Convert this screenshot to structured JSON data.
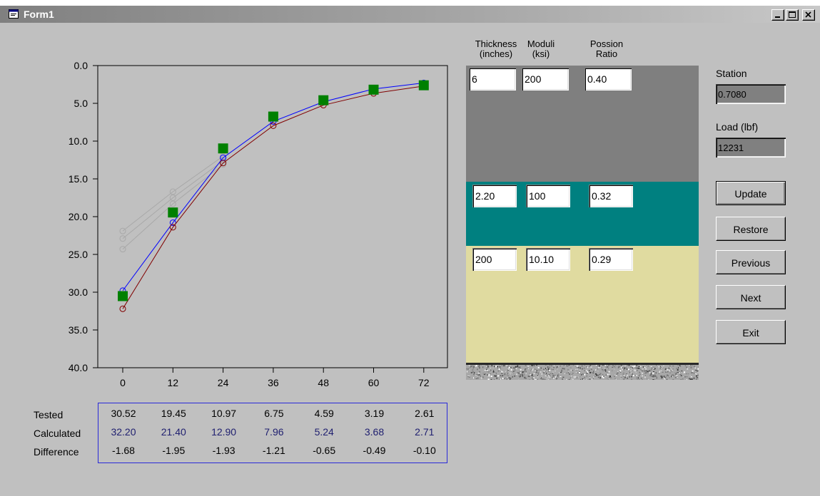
{
  "window": {
    "title": "Form1",
    "controls": {
      "minimize": "minimize",
      "maximize": "maximize",
      "close": "close"
    }
  },
  "chart_data": {
    "type": "line",
    "title": "",
    "xlabel": "",
    "ylabel": "",
    "x": [
      0,
      12,
      24,
      36,
      48,
      60,
      72
    ],
    "x_tick_labels": [
      "0",
      "12",
      "24",
      "36",
      "48",
      "60",
      "72"
    ],
    "ylim": [
      0,
      40
    ],
    "y_inverted": true,
    "y_ticks": [
      0,
      5,
      10,
      15,
      20,
      25,
      30,
      35,
      40
    ],
    "y_tick_labels": [
      "0.0",
      "5.0",
      "10.0",
      "15.0",
      "20.0",
      "25.0",
      "30.0",
      "35.0",
      "40.0"
    ],
    "grid": false,
    "series": [
      {
        "role": "tested",
        "marker": "square",
        "color": "#008000",
        "values": [
          30.52,
          19.45,
          10.97,
          6.75,
          4.59,
          3.19,
          2.61
        ]
      },
      {
        "role": "calculated",
        "marker": "circle",
        "color": "#800000",
        "values": [
          32.2,
          21.4,
          12.9,
          7.96,
          5.24,
          3.68,
          2.71
        ]
      },
      {
        "role": "previous-fit",
        "marker": "circle",
        "color": "#0000ff",
        "values": [
          29.8,
          20.8,
          12.2,
          7.4,
          4.8,
          3.1,
          2.3
        ]
      },
      {
        "role": "earlier-fit",
        "marker": "circle",
        "color": "#a8a8a8",
        "values": [
          21.9,
          16.7,
          12.0
        ]
      },
      {
        "role": "earlier-fit",
        "marker": "circle",
        "color": "#a8a8a8",
        "values": [
          22.9,
          17.5,
          12.6
        ]
      },
      {
        "role": "earlier-fit",
        "marker": "circle",
        "color": "#a8a8a8",
        "values": [
          24.3,
          18.3,
          13.1
        ]
      }
    ]
  },
  "table": {
    "row_labels": [
      "Tested",
      "Calculated",
      "Difference"
    ],
    "tested": [
      "30.52",
      "19.45",
      "10.97",
      "6.75",
      "4.59",
      "3.19",
      "2.61"
    ],
    "calculated": [
      "32.20",
      "21.40",
      "12.90",
      "7.96",
      "5.24",
      "3.68",
      "2.71"
    ],
    "difference": [
      "-1.68",
      "-1.95",
      "-1.93",
      "-1.21",
      "-0.65",
      "-0.49",
      "-0.10"
    ]
  },
  "headers": {
    "thickness": [
      "Thickness",
      "(inches)"
    ],
    "moduli": [
      "Moduli",
      "(ksi)"
    ],
    "poisson": [
      "Possion",
      "Ratio"
    ]
  },
  "layers": [
    {
      "thickness": "6",
      "moduli": "200",
      "poisson": "0.40",
      "color": "#7f7f7f"
    },
    {
      "thickness": "2.20",
      "moduli": "100",
      "poisson": "0.32",
      "color": "#008080"
    },
    {
      "thickness": "200",
      "moduli": "10.10",
      "poisson": "0.29",
      "color": "#e0dba0"
    }
  ],
  "station": {
    "label": "Station",
    "value": "0.7080"
  },
  "load": {
    "label": "Load  (lbf)",
    "value": "12231"
  },
  "buttons": {
    "update": "Update",
    "restore": "Restore",
    "previous": "Previous",
    "next": "Next",
    "exit": "Exit"
  }
}
